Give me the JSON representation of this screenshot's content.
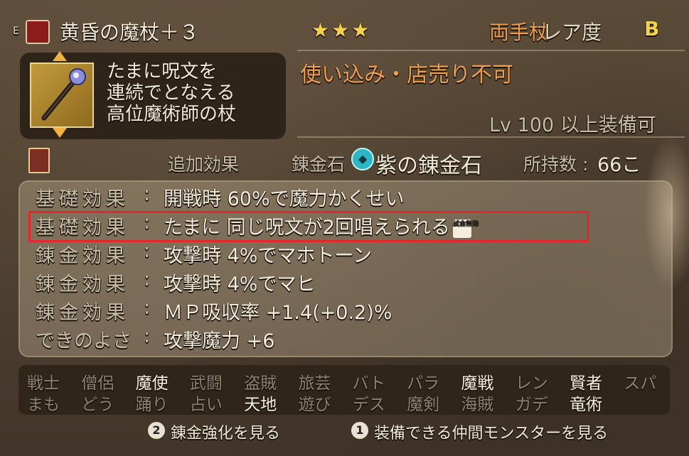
{
  "header": {
    "equip_tag": "E",
    "item_name": "黄昏の魔杖＋３",
    "stars": "★★★",
    "weapon_type": "両手杖",
    "rarity_label": "レア度",
    "rarity_grade": "B"
  },
  "description": {
    "lines": [
      "たまに呪文を",
      "連続でとなえる",
      "高位魔術師の杖"
    ],
    "restriction": "使い込み・店売り不可",
    "level_req": "Lv 100 以上装備可"
  },
  "subheader": {
    "extra_effects": "追加効果",
    "stone_label": "錬金石",
    "stone_name": "紫の錬金石",
    "count_label": "所持数 :",
    "count_value": "66こ"
  },
  "effects": [
    {
      "label": "基礎効果",
      "value": "開戦時 60%で魔力かくせい",
      "badge": ""
    },
    {
      "label": "基礎効果",
      "value": "たまに 同じ呪文が2回唱えられる",
      "badge": "試合無効"
    },
    {
      "label": "錬金効果",
      "value": "攻撃時 4%でマホトーン",
      "badge": ""
    },
    {
      "label": "錬金効果",
      "value": "攻撃時 4%でマヒ",
      "badge": ""
    },
    {
      "label": "錬金効果",
      "value": "ＭＰ吸収率 +1.4(+0.2)%",
      "badge": ""
    },
    {
      "label": "できのよさ",
      "value": "攻撃魔力 +6",
      "badge": ""
    }
  ],
  "jobs": {
    "row1": [
      {
        "name": "戦士",
        "active": false
      },
      {
        "name": "僧侶",
        "active": false
      },
      {
        "name": "魔使",
        "active": true
      },
      {
        "name": "武闘",
        "active": false
      },
      {
        "name": "盗賊",
        "active": false
      },
      {
        "name": "旅芸",
        "active": false
      },
      {
        "name": "バト",
        "active": false
      },
      {
        "name": "パラ",
        "active": false
      },
      {
        "name": "魔戦",
        "active": true
      },
      {
        "name": "レン",
        "active": false
      },
      {
        "name": "賢者",
        "active": true
      },
      {
        "name": "スパ",
        "active": false
      }
    ],
    "row2": [
      {
        "name": "まも",
        "active": false
      },
      {
        "name": "どう",
        "active": false
      },
      {
        "name": "踊り",
        "active": false
      },
      {
        "name": "占い",
        "active": false
      },
      {
        "name": "天地",
        "active": true
      },
      {
        "name": "遊び",
        "active": false
      },
      {
        "name": "デス",
        "active": false
      },
      {
        "name": "魔剣",
        "active": false
      },
      {
        "name": "海賊",
        "active": false
      },
      {
        "name": "ガデ",
        "active": false
      },
      {
        "name": "竜術",
        "active": true
      }
    ]
  },
  "footer": {
    "btn2_num": "2",
    "btn2_text": "錬金強化を見る",
    "btn1_num": "1",
    "btn1_text": "装備できる仲間モンスターを見る"
  }
}
